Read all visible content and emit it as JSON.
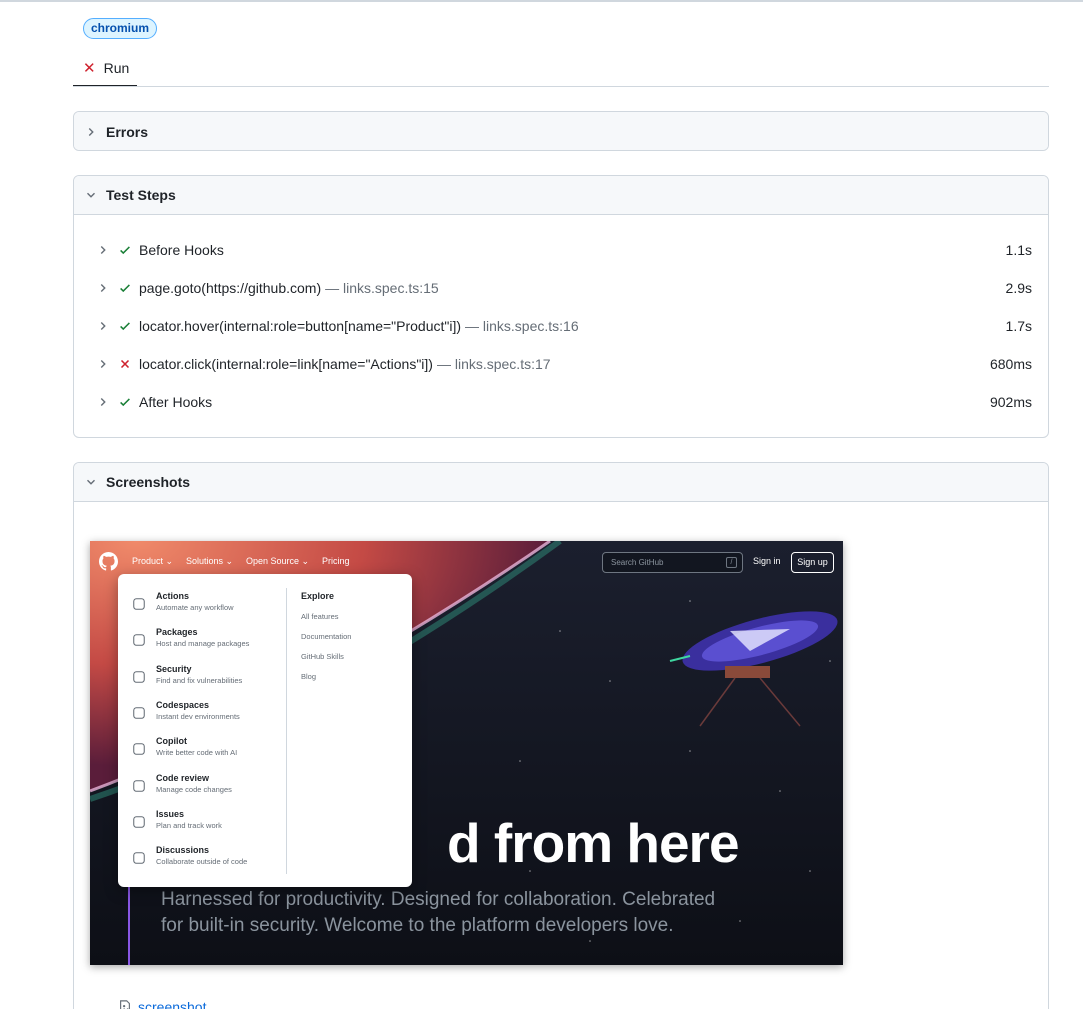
{
  "project_badge": "chromium",
  "tab": {
    "label": "Run",
    "status": "failed"
  },
  "sections": {
    "errors": "Errors",
    "test_steps": "Test Steps",
    "screenshots": "Screenshots"
  },
  "steps": [
    {
      "status": "passed",
      "title": "Before Hooks",
      "location": "",
      "duration": "1.1s"
    },
    {
      "status": "passed",
      "title": "page.goto(https://github.com)",
      "location": "— links.spec.ts:15",
      "duration": "2.9s"
    },
    {
      "status": "passed",
      "title": "locator.hover(internal:role=button[name=\"Product\"i])",
      "location": "— links.spec.ts:16",
      "duration": "1.7s"
    },
    {
      "status": "failed",
      "title": "locator.click(internal:role=link[name=\"Actions\"i])",
      "location": "— links.spec.ts:17",
      "duration": "680ms"
    },
    {
      "status": "passed",
      "title": "After Hooks",
      "location": "",
      "duration": "902ms"
    }
  ],
  "screenshot": {
    "nav": {
      "product": "Product",
      "solutions": "Solutions",
      "open_source": "Open Source",
      "pricing": "Pricing",
      "search_placeholder": "Search GitHub",
      "search_key": "/",
      "sign_in": "Sign in",
      "sign_up": "Sign up"
    },
    "menu": [
      {
        "title": "Actions",
        "subtitle": "Automate any workflow",
        "icon": "workflow-icon"
      },
      {
        "title": "Packages",
        "subtitle": "Host and manage packages",
        "icon": "package-icon"
      },
      {
        "title": "Security",
        "subtitle": "Find and fix vulnerabilities",
        "icon": "shield-check-icon"
      },
      {
        "title": "Codespaces",
        "subtitle": "Instant dev environments",
        "icon": "codespaces-icon"
      },
      {
        "title": "Copilot",
        "subtitle": "Write better code with AI",
        "icon": "copilot-icon"
      },
      {
        "title": "Code review",
        "subtitle": "Manage code changes",
        "icon": "code-review-icon"
      },
      {
        "title": "Issues",
        "subtitle": "Plan and track work",
        "icon": "issue-icon"
      },
      {
        "title": "Discussions",
        "subtitle": "Collaborate outside of code",
        "icon": "comment-discussion-icon"
      }
    ],
    "explore": {
      "heading": "Explore",
      "links": [
        "All features",
        "Documentation",
        "GitHub Skills",
        "Blog"
      ]
    },
    "hero_fragment": "d from here",
    "hero_sub": "Harnessed for productivity. Designed for collaboration. Celebrated for built-in security. Welcome to the platform developers love."
  },
  "attachment": {
    "label": "screenshot",
    "icon": "file-media-icon"
  },
  "colors": {
    "pass": "#1a7f37",
    "fail": "#cf222e",
    "link": "#0969da",
    "accent_purple": "#8957e5"
  }
}
